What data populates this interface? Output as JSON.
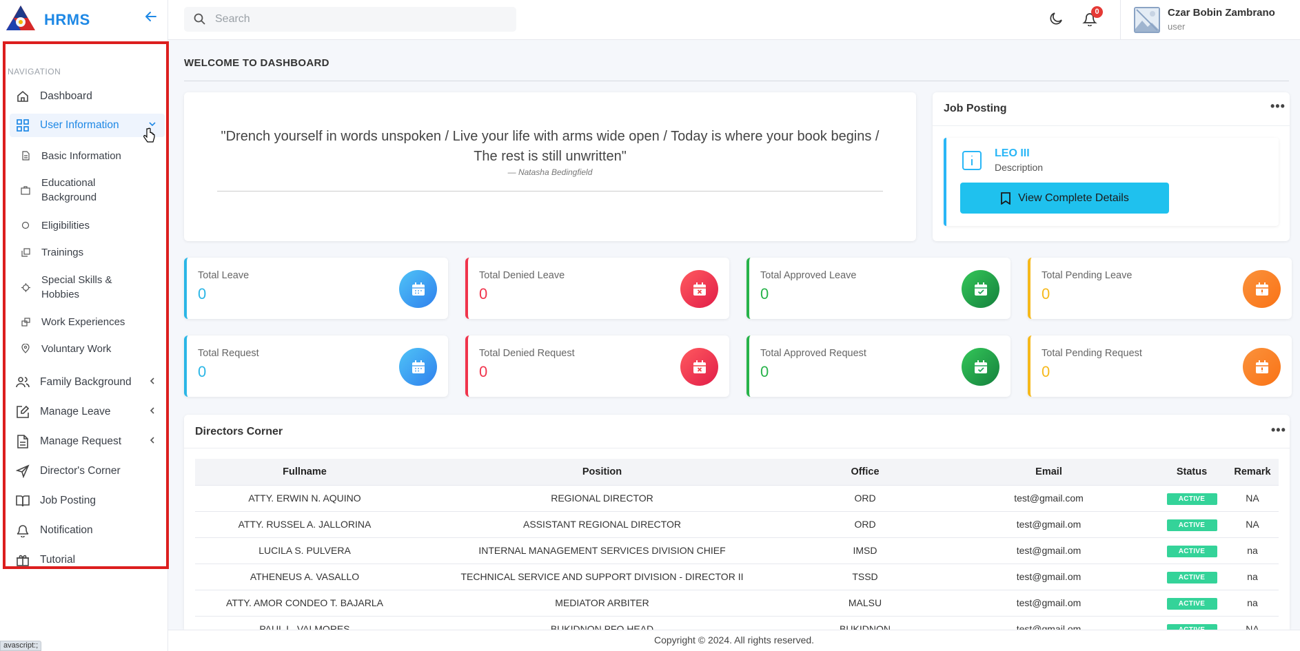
{
  "brand": {
    "name": "HRMS"
  },
  "colors": {
    "accent": "#1e88e5",
    "nav_highlight_border": "#dc1e1e",
    "cyan": "#1fc1ee",
    "red": "#f43f5e",
    "green": "#22c55e",
    "yellow": "#fbbf24"
  },
  "sidebar": {
    "heading": "NAVIGATION",
    "items": [
      {
        "label": "Dashboard",
        "icon": "home-icon"
      },
      {
        "label": "User Information",
        "icon": "grid-icon",
        "active": true,
        "expanded": true
      },
      {
        "label": "Basic Information",
        "icon": "document-icon"
      },
      {
        "label": "Educational Background",
        "icon": "briefcase-icon"
      },
      {
        "label": "Eligibilities",
        "icon": "circle-icon"
      },
      {
        "label": "Trainings",
        "icon": "copy-icon"
      },
      {
        "label": "Special Skills & Hobbies",
        "icon": "target-icon"
      },
      {
        "label": "Work Experiences",
        "icon": "layers-icon"
      },
      {
        "label": "Voluntary Work",
        "icon": "location-pin-icon"
      },
      {
        "label": "Family Background",
        "icon": "users-icon"
      },
      {
        "label": "Manage Leave",
        "icon": "edit-square-icon"
      },
      {
        "label": "Manage Request",
        "icon": "file-text-icon"
      },
      {
        "label": "Director's Corner",
        "icon": "send-icon"
      },
      {
        "label": "Job Posting",
        "icon": "book-open-icon"
      },
      {
        "label": "Notification",
        "icon": "bell-icon"
      },
      {
        "label": "Tutorial",
        "icon": "gift-icon"
      }
    ]
  },
  "topbar": {
    "search_placeholder": "Search",
    "notification_count": "0",
    "user_name": "Czar Bobin Zambrano",
    "user_role": "user"
  },
  "welcome": "WELCOME TO DASHBOARD",
  "quote": {
    "text": "\"Drench yourself in words unspoken / Live your life with arms wide open / Today is where your book begins / The rest is still unwritten\"",
    "author": "— Natasha Bedingfield"
  },
  "job_posting": {
    "title": "Job Posting",
    "job_name": "LEO III",
    "job_desc": "Description",
    "button": "View Complete Details"
  },
  "stats": [
    {
      "label": "Total Leave",
      "value": "0",
      "color": "#2bb6e6",
      "icon": "calendar-icon"
    },
    {
      "label": "Total Denied Leave",
      "value": "0",
      "color": "#f0344c",
      "icon": "calendar-x-icon"
    },
    {
      "label": "Total Approved Leave",
      "value": "0",
      "color": "#27b34a",
      "icon": "calendar-check-icon"
    },
    {
      "label": "Total Pending Leave",
      "value": "0",
      "color": "#f6b91c",
      "icon": "calendar-alert-icon"
    },
    {
      "label": "Total Request",
      "value": "0",
      "color": "#2bb6e6",
      "icon": "calendar-icon"
    },
    {
      "label": "Total Denied Request",
      "value": "0",
      "color": "#f0344c",
      "icon": "calendar-x-icon"
    },
    {
      "label": "Total Approved Request",
      "value": "0",
      "color": "#27b34a",
      "icon": "calendar-check-icon"
    },
    {
      "label": "Total Pending Request",
      "value": "0",
      "color": "#f6b91c",
      "icon": "calendar-alert-icon"
    }
  ],
  "directors": {
    "title": "Directors Corner",
    "columns": [
      "Fullname",
      "Position",
      "Office",
      "Email",
      "Status",
      "Remark"
    ],
    "rows": [
      [
        "ATTY. ERWIN N. AQUINO",
        "REGIONAL DIRECTOR",
        "ORD",
        "test@gmail.com",
        "ACTIVE",
        "NA"
      ],
      [
        "ATTY. RUSSEL A. JALLORINA",
        "ASSISTANT REGIONAL DIRECTOR",
        "ORD",
        "test@gmail.om",
        "ACTIVE",
        "NA"
      ],
      [
        "LUCILA S. PULVERA",
        "INTERNAL MANAGEMENT SERVICES DIVISION CHIEF",
        "IMSD",
        "test@gmail.om",
        "ACTIVE",
        "na"
      ],
      [
        "ATHENEUS A. VASALLO",
        "TECHNICAL SERVICE AND SUPPORT DIVISION - DIRECTOR II",
        "TSSD",
        "test@gmail.om",
        "ACTIVE",
        "na"
      ],
      [
        "ATTY. AMOR CONDEO T. BAJARLA",
        "MEDIATOR ARBITER",
        "MALSU",
        "test@gmail.om",
        "ACTIVE",
        "na"
      ],
      [
        "PAUL L. VALMORES",
        "BUKIDNON PFO HEAD",
        "BUKIDNON",
        "test@gmail.om",
        "ACTIVE",
        "NA"
      ]
    ]
  },
  "footer": "Copyright © 2024. All rights reserved.",
  "status_bar": "avascript:;"
}
